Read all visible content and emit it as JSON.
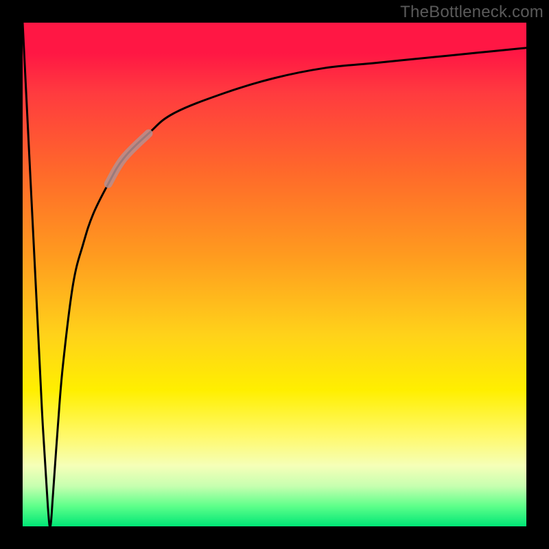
{
  "watermark": "TheBottleneck.com",
  "colors": {
    "frame": "#000000",
    "curve": "#000000",
    "curve_highlight": "#b68f8f"
  },
  "chart_data": {
    "type": "line",
    "title": "",
    "xlabel": "",
    "ylabel": "",
    "xlim": [
      0,
      100
    ],
    "ylim": [
      0,
      100
    ],
    "grid": false,
    "legend": false,
    "annotations": [
      {
        "text": "TheBottleneck.com",
        "position": "top-right"
      }
    ],
    "series": [
      {
        "name": "bottleneck-curve",
        "notes": "Curve drops sharply from 100 at x≈0 to ~0 at x≈5.5 (minimum), then rises steeply and asymptotically toward ~95 at x=100. Values estimated from pixel positions; no axis ticks are shown.",
        "x": [
          0,
          1,
          2,
          3,
          4,
          5,
          5.5,
          6,
          7,
          8,
          10,
          12,
          14,
          17,
          20,
          25,
          30,
          40,
          50,
          60,
          70,
          80,
          90,
          100
        ],
        "values": [
          100,
          80,
          60,
          40,
          20,
          4,
          0,
          6,
          20,
          32,
          48,
          56,
          62,
          68,
          73,
          78,
          82,
          86,
          89,
          91,
          92,
          93,
          94,
          95
        ],
        "highlight_range_x": [
          17,
          25
        ]
      }
    ]
  }
}
